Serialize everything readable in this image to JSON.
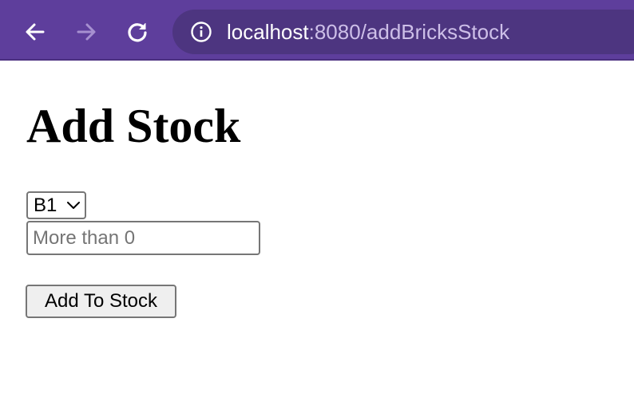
{
  "browser": {
    "url_host": "localhost",
    "url_rest": ":8080/addBricksStock",
    "toolbar_color": "#5e3e9c",
    "urlbar_color": "#4d3580",
    "icons": [
      "back-arrow-icon",
      "forward-arrow-icon",
      "reload-icon",
      "info-icon"
    ]
  },
  "page": {
    "title": "Add Stock",
    "select": {
      "selected": "B1"
    },
    "quantity_input": {
      "value": "",
      "placeholder": "More than 0"
    },
    "submit_label": "Add To Stock"
  }
}
